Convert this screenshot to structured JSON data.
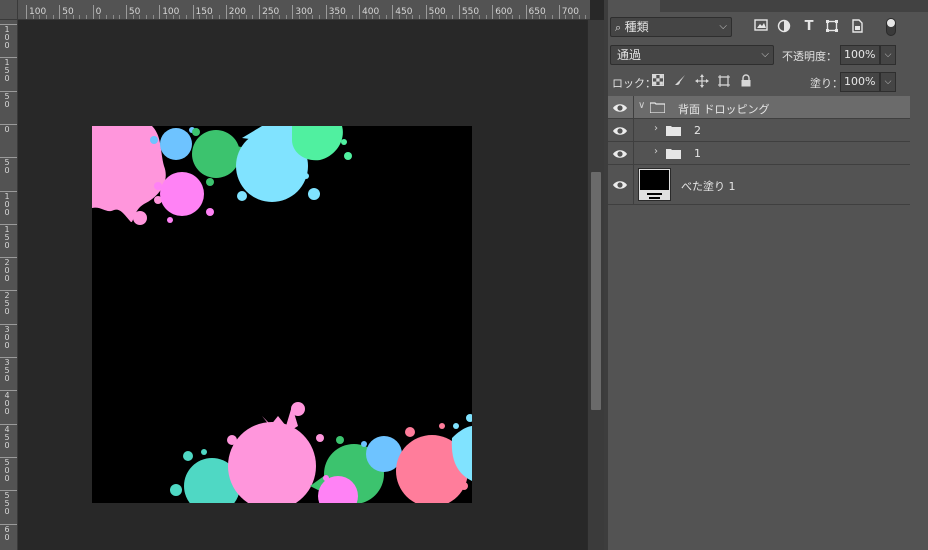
{
  "rulers": {
    "top_labels": [
      "100",
      "50",
      "0",
      "50",
      "100",
      "150",
      "200",
      "250",
      "300",
      "350",
      "400",
      "450",
      "500",
      "550",
      "600",
      "650",
      "700"
    ],
    "left_labels": [
      "1 0 0",
      "1 5 0",
      "5 0",
      "0",
      "5 0",
      "1 0 0",
      "1 5 0",
      "2 0 0",
      "2 5 0",
      "3 0 0",
      "3 5 0",
      "4 0 0",
      "4 5 0",
      "5 0 0",
      "5 5 0",
      "6 0"
    ]
  },
  "layers_panel": {
    "filter": {
      "kind_label": "種類",
      "icons": [
        "image-filter-icon",
        "adjustment-filter-icon",
        "type-filter-icon",
        "shape-filter-icon",
        "smart-object-filter-icon"
      ]
    },
    "blend_mode": "通過",
    "opacity_label": "不透明度：",
    "opacity_value": "100%",
    "lock_label": "ロック：",
    "fill_label": "塗り：",
    "fill_value": "100%",
    "layers": [
      {
        "name": "背面 ドロッピング",
        "type": "group",
        "expanded": true,
        "selected": true
      },
      {
        "name": "2",
        "type": "group",
        "expanded": false
      },
      {
        "name": "1",
        "type": "group",
        "expanded": false
      },
      {
        "name": "べた塗り 1",
        "type": "fill"
      }
    ]
  },
  "colors": {
    "canvas_bg": "#000000",
    "pink": "#ff96dc",
    "light_blue": "#6ec3ff",
    "green": "#3cc36e",
    "cyan": "#80e3ff",
    "mint": "#50f0a0",
    "magenta": "#ff82f5",
    "teal": "#4fd8c4",
    "salmon": "#ff7d9b"
  }
}
